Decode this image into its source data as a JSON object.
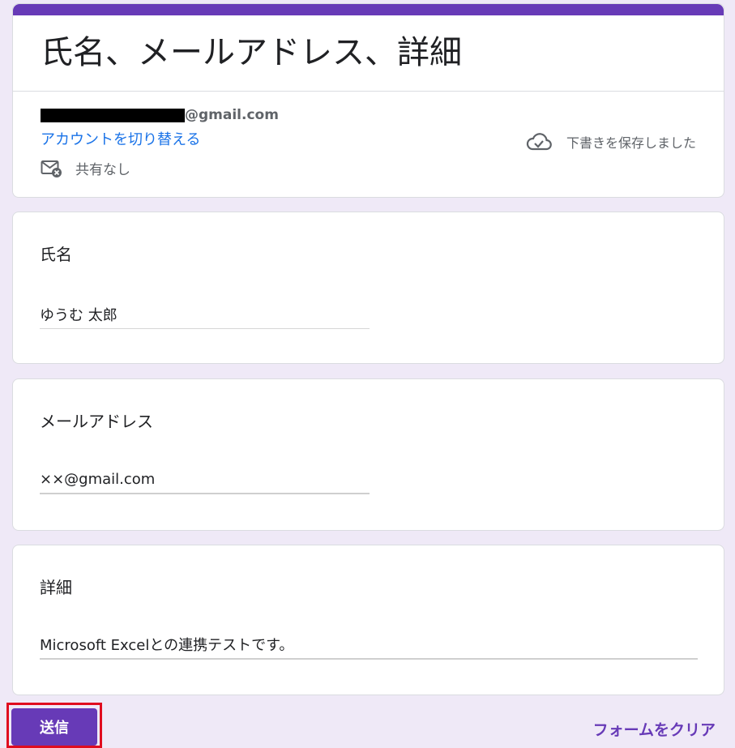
{
  "header": {
    "form_title": "氏名、メールアドレス、詳細",
    "account_domain": "@gmail.com",
    "switch_account": "アカウントを切り替える",
    "sharing": "共有なし",
    "draft_status": "下書きを保存しました"
  },
  "questions": [
    {
      "label": "氏名",
      "value": "ゆうむ 太郎"
    },
    {
      "label": "メールアドレス",
      "value": "××@gmail.com"
    },
    {
      "label": "詳細",
      "value": "Microsoft Excelとの連携テストです。"
    }
  ],
  "footer": {
    "submit_label": "送信",
    "clear_label": "フォームをクリア"
  },
  "icons": {
    "mail": "mail-not-shared-icon",
    "cloud": "cloud-check-icon"
  },
  "colors": {
    "accent": "#673ab7",
    "link": "#1a73e8",
    "highlight": "#e00c1f",
    "background": "#efe9f7"
  }
}
